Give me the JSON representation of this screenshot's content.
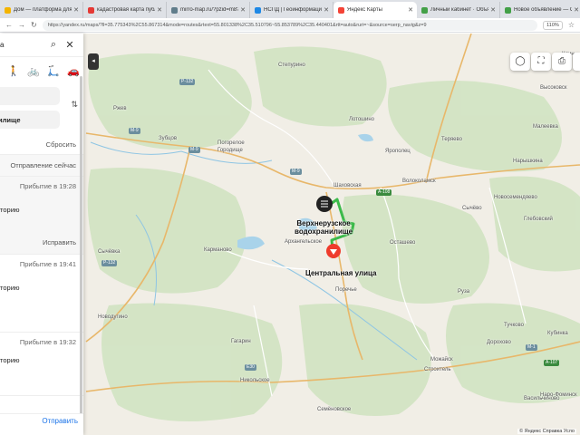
{
  "browser": {
    "tabs": [
      {
        "label": "Дом — платформа для про",
        "color": "#f4b400",
        "active": false
      },
      {
        "label": "кадастровая карта публичн",
        "color": "#e53935",
        "active": false
      },
      {
        "label": "mirro-map.ru/?pzid=m8?qe",
        "color": "#607d8b",
        "active": false
      },
      {
        "label": "НСПД | Геоинформационн",
        "color": "#1e88e5",
        "active": false
      },
      {
        "label": "Яндекс Карты",
        "color": "#f44336",
        "active": true
      },
      {
        "label": "Личный кабинет · Объявлен",
        "color": "#43a047",
        "active": false
      },
      {
        "label": "Новое объявление — Объ",
        "color": "#43a047",
        "active": false
      }
    ],
    "url": "https://yandex.ru/maps/?ll=35.775343%2C55.867314&mode=routes&rtext=55.801338%2C35.510796~55.853789%2C35.440401&rtt=auto&ruri=~&source=serp_navig&z=9",
    "zoom": "110%"
  },
  "panel": {
    "search_text": "а",
    "search_icon": "search-icon",
    "close_icon": "close-icon",
    "modes": [
      "walk",
      "bike",
      "scooter",
      "car"
    ],
    "to_field": "илище",
    "reset": "Сбросить",
    "departure": "Отправление сейчас",
    "routes": [
      {
        "arrival": "Прибытие в 19:28",
        "via": "торию",
        "fix": "Исправить"
      },
      {
        "arrival": "Прибытие в 19:41",
        "via": "торию",
        "fix": ""
      },
      {
        "arrival": "Прибытие в 19:32",
        "via": "торию",
        "fix": ""
      }
    ],
    "send": "Отправить"
  },
  "map": {
    "labels": {
      "steprjatino": "Степурино",
      "rzhev": "Ржев",
      "zubtsov": "Зубцов",
      "pogoreloe": "Погорелое\nГородище",
      "lotoshino": "Лотошино",
      "yaropolets": "Ярополец",
      "teryaevo": "Теряево",
      "shakhovskaya": "Шаховская",
      "volokolamsk": "Волоколамск",
      "sychyovo": "Сычёво",
      "sychevka": "Сычёвка",
      "karmanovo": "Карманово",
      "arkhangelskoe": "Архангельское",
      "ostashevo": "Осташево",
      "poreche": "Поречье",
      "ruza": "Руза",
      "novodugino": "Новодугино",
      "gagarin": "Гагарин",
      "nikolskoe": "Никольское",
      "mozhaysk": "Можайск",
      "stroitel": "Строитель",
      "semenovskoe": "Семёновское",
      "klin": "Клин",
      "vysokovsk": "Высоковск",
      "malevka": "Малеевка",
      "naryshkina": "Нарышкина",
      "novosemendyaevo": "Новосемендяево",
      "glebovskiy": "Глебовский",
      "tuchkovo": "Тучково",
      "dorokhovo": "Дорохово",
      "kubinka": "Кубинка",
      "vasilchinovo": "Васильчиново",
      "naro_fominsk": "Наро-Фоминск",
      "start": "Верхнерузское\nводохранилище",
      "end": "Центральная улица"
    },
    "shields": {
      "p132a": "Р-132",
      "m9a": "М-9",
      "m9b": "М-9",
      "m9c": "М-9",
      "a108": "А-108",
      "p132b": "Р-132",
      "e30": "Е30",
      "m1": "М-1",
      "a107": "А-107"
    },
    "route_color": "#3cba4a",
    "end_marker_color": "#ef3b2c",
    "copyright": "© Яндекс  Справка  Усло"
  }
}
